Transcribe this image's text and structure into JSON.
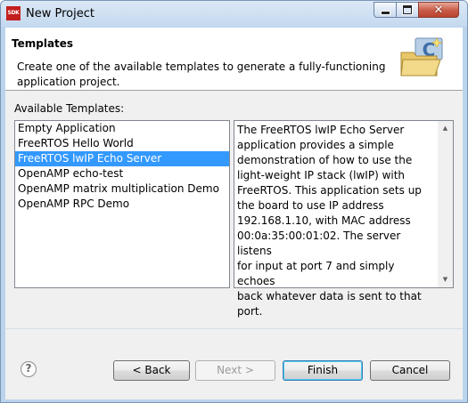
{
  "window": {
    "title": "New Project",
    "app_icon_text": "SDK",
    "min_glyph": "minimize-icon",
    "max_glyph": "maximize-icon",
    "close_glyph": "✕"
  },
  "banner": {
    "title": "Templates",
    "description": "Create one of the available templates to generate a fully-functioning application project.",
    "graphic": "new-c-project-folder-icon"
  },
  "templates": {
    "label": "Available Templates:",
    "items": [
      {
        "label": "Empty Application"
      },
      {
        "label": "FreeRTOS Hello World"
      },
      {
        "label": "FreeRTOS lwIP Echo Server"
      },
      {
        "label": "OpenAMP echo-test"
      },
      {
        "label": "OpenAMP matrix multiplication Demo"
      },
      {
        "label": "OpenAMP RPC Demo"
      }
    ],
    "selected_index": 2
  },
  "description": {
    "text": "The FreeRTOS lwIP Echo Server\napplication provides a simple\ndemonstration of how to use the\nlight-weight IP stack (lwIP) with\nFreeRTOS. This application sets up\nthe board to use IP address\n192.168.1.10, with MAC address\n00:0a:35:00:01:02. The server listens\nfor input at port 7 and simply echoes\nback whatever data is sent to that\nport."
  },
  "buttons": {
    "help": "?",
    "back": "< Back",
    "next": "Next >",
    "finish": "Finish",
    "cancel": "Cancel"
  },
  "colors": {
    "selection": "#3399ff",
    "dialog_bg": "#f0f0f0",
    "finish_border": "#3c7fb1"
  }
}
